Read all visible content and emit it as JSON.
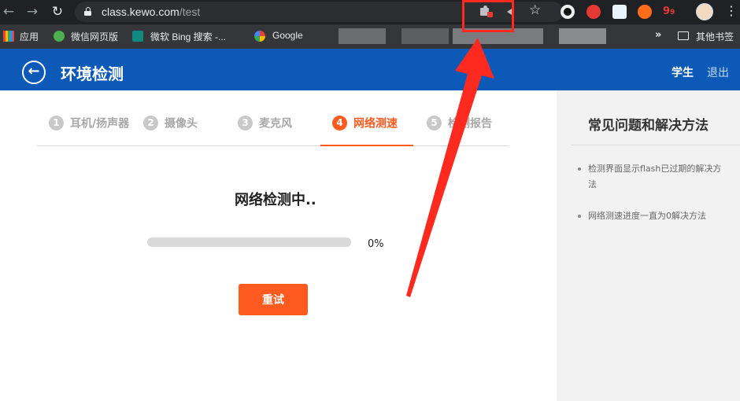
{
  "browser": {
    "url_host": "class.kewo.com",
    "url_path": "/test",
    "bookmarks": [
      {
        "label": "应用"
      },
      {
        "label": "微信网页版"
      },
      {
        "label": "微软 Bing 搜索 -..."
      },
      {
        "label": "Google"
      }
    ],
    "other_bookmarks": "其他书签"
  },
  "header": {
    "title": "环境检测",
    "user": "学生",
    "logout": "退出"
  },
  "steps": [
    {
      "num": "1",
      "label": "耳机/扬声器"
    },
    {
      "num": "2",
      "label": "摄像头"
    },
    {
      "num": "3",
      "label": "麦克风"
    },
    {
      "num": "4",
      "label": "网络测速"
    },
    {
      "num": "5",
      "label": "检测报告"
    }
  ],
  "active_step": 4,
  "detection": {
    "status": "网络检测中..",
    "progress_percent": 0,
    "progress_text": "0%",
    "retry_label": "重试"
  },
  "faq": {
    "title": "常见问题和解决方法",
    "items": [
      "检测界面显示flash已过期的解决方法",
      "网络测速进度一直为0解决方法"
    ]
  },
  "colors": {
    "accent": "#ff5a1f",
    "header_blue": "#0c59b8",
    "annotation_red": "#ff2a1f"
  }
}
